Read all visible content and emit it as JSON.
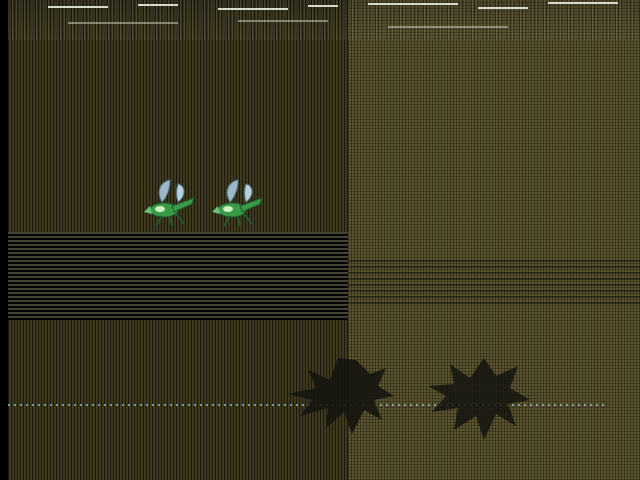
{
  "scene": {
    "background_left": "#3f3a1e",
    "background_right": "#5c5530",
    "sprite_colors": {
      "wing": "#9ab8c8",
      "body": "#3a9a4a",
      "highlight": "#d0f0c0",
      "outline": "#1e5a2a"
    },
    "shadow_color": "#151510"
  },
  "sprites": [
    {
      "name": "winged-creature-1",
      "icon": "winged-bug-icon"
    },
    {
      "name": "winged-creature-2",
      "icon": "winged-bug-icon"
    }
  ],
  "shadows": [
    {
      "name": "shadow-creature-1",
      "icon": "shadow-silhouette-icon"
    },
    {
      "name": "shadow-creature-2",
      "icon": "shadow-silhouette-icon"
    }
  ]
}
